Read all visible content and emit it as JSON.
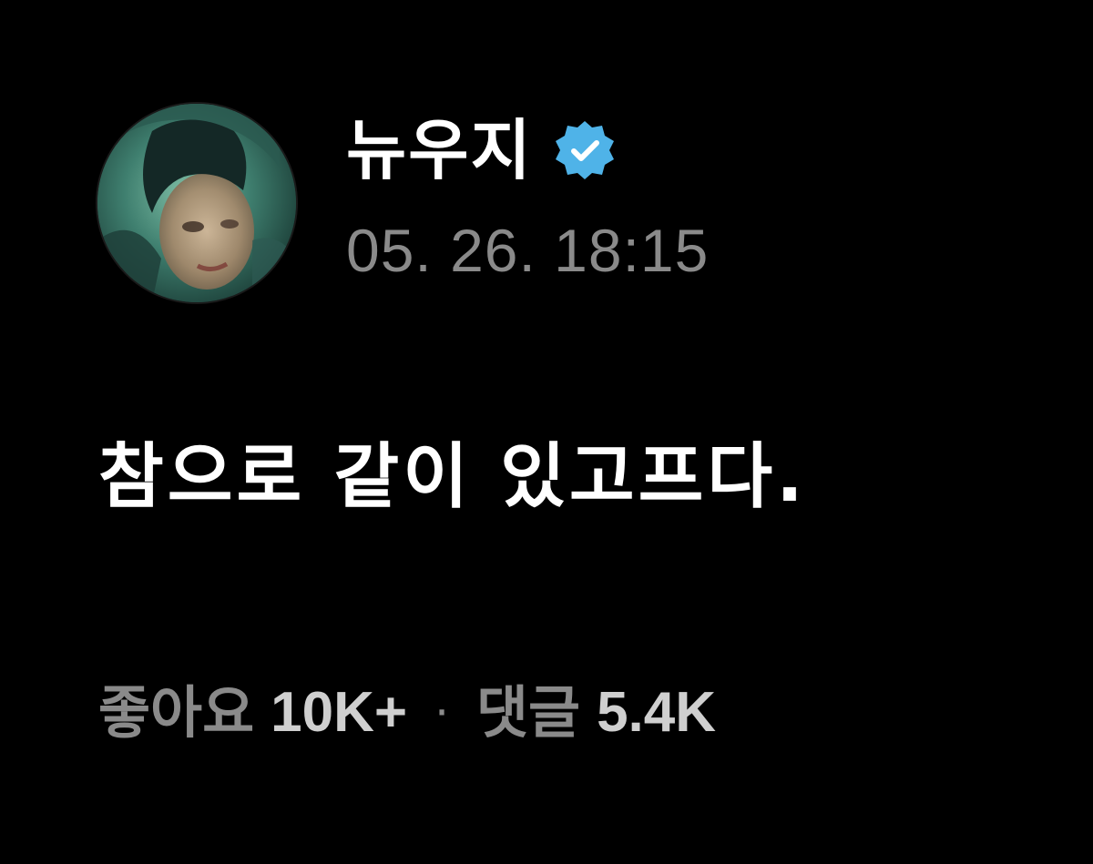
{
  "post": {
    "author": {
      "name": "뉴우지",
      "verified": true,
      "badge_color": "#4fb3e8"
    },
    "timestamp": "05. 26. 18:15",
    "text": "참으로 같이 있고프다.",
    "stats": {
      "likes_label": "좋아요",
      "likes_value": "10K+",
      "separator": "·",
      "comments_label": "댓글",
      "comments_value": "5.4K"
    }
  },
  "colors": {
    "background": "#000000",
    "primary_text": "#ffffff",
    "secondary_text": "#8a8a8a",
    "verified_badge": "#4fb3e8"
  }
}
